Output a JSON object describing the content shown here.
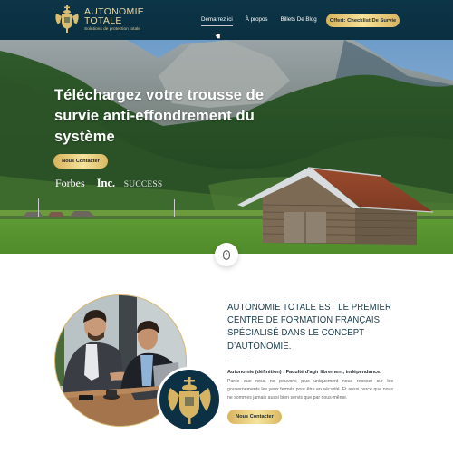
{
  "header": {
    "logo": {
      "title_line1": "AUTONOMIE",
      "title_line2": "TOTALE",
      "tagline": "Solutions de protection totale",
      "icon": "coat-of-arms-icon"
    },
    "nav": [
      {
        "label": "Démarrez ici",
        "active": true
      },
      {
        "label": "À propos",
        "active": false
      },
      {
        "label": "Billets De Blog",
        "active": false
      }
    ],
    "cta_label": "Offert: Checklist De Survie"
  },
  "hero": {
    "title": "Téléchargez votre trousse de survie anti-effondrement du système",
    "button_label": "Nous Contacter",
    "press_logos": [
      "Forbes",
      "Inc.",
      "SUCCESS"
    ]
  },
  "scroll": {
    "icon": "mouse-scroll-icon"
  },
  "about": {
    "heading": "AUTONOMIE TOTALE EST LE PREMIER CENTRE DE FORMATION FRANÇAIS SPÉCIALISÉ DANS LE CONCEPT D’AUTONOMIE.",
    "definition": "Autonomie (définition) : Faculté d'agir librement, indépendance.",
    "body": "Parce que nous ne pouvons plus uniquement nous reposer sur les gouvernements les yeux fermés pour être en sécurité. Et aussi parce que nous ne sommes jamais aussi bien servis que par nous-même.",
    "button_label": "Nous Contacter"
  },
  "colors": {
    "header_bg": "#0c3547",
    "gold": "#e6c878",
    "heading_navy": "#1a3a4a"
  }
}
